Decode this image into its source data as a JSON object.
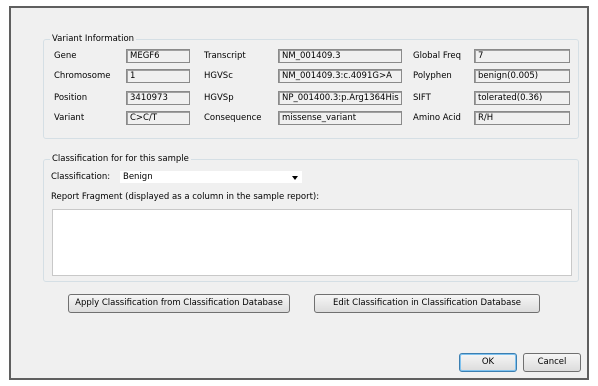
{
  "variant_info": {
    "title": "Variant Information",
    "fields": [
      {
        "label": "Gene",
        "value": "MEGF6"
      },
      {
        "label": "Chromosome",
        "value": "1"
      },
      {
        "label": "Position",
        "value": "3410973"
      },
      {
        "label": "Variant",
        "value": "C>C/T"
      },
      {
        "label": "Transcript",
        "value": "NM_001409.3"
      },
      {
        "label": "HGVSc",
        "value": "NM_001409.3:c.4091G>A"
      },
      {
        "label": "HGVSp",
        "value": "NP_001400.3:p.Arg1364His"
      },
      {
        "label": "Consequence",
        "value": "missense_variant"
      },
      {
        "label": "Global Freq",
        "value": "7"
      },
      {
        "label": "Polyphen",
        "value": "benign(0.005)"
      },
      {
        "label": "SIFT",
        "value": "tolerated(0.36)"
      },
      {
        "label": "Amino Acid",
        "value": "R/H"
      }
    ]
  },
  "classification": {
    "title": "Classification for for this sample",
    "label": "Classification:",
    "selected": "Benign",
    "report_label": "Report Fragment (displayed as a column in the sample report):",
    "report_value": ""
  },
  "buttons": {
    "apply": "Apply Classification from Classification Database",
    "edit": "Edit Classification in Classification Database",
    "ok": "OK",
    "cancel": "Cancel"
  }
}
